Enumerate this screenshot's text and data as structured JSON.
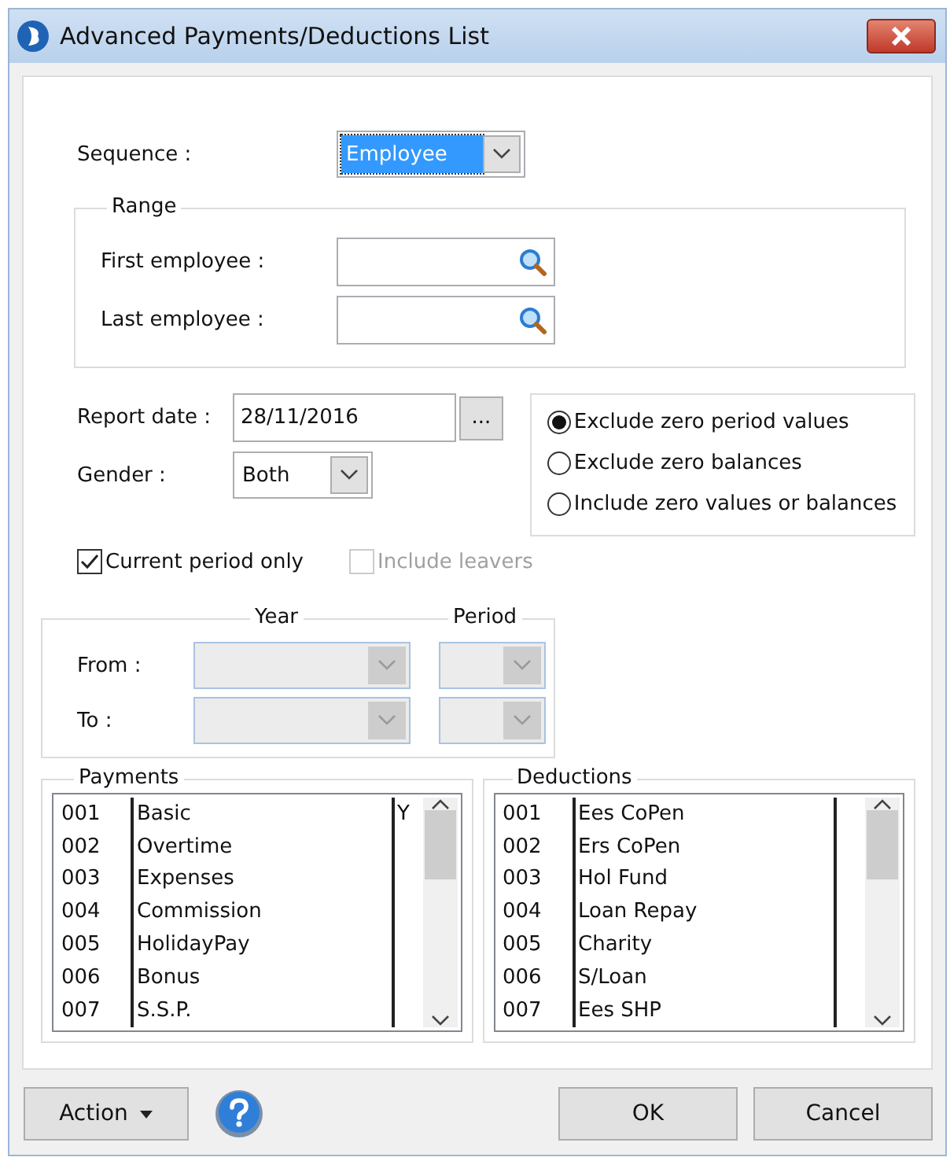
{
  "window": {
    "title": "Advanced Payments/Deductions List"
  },
  "sequence": {
    "label": "Sequence :",
    "value": "Employee",
    "focused": true
  },
  "range": {
    "title": "Range",
    "fields": [
      {
        "label": "First employee :"
      },
      {
        "label": "Last employee :"
      }
    ]
  },
  "report_date": {
    "label": "Report date :",
    "value": "28/11/2016",
    "button": "..."
  },
  "gender": {
    "label": "Gender :",
    "value": "Both"
  },
  "zero_options": [
    {
      "label": "Exclude zero period values",
      "selected": true
    },
    {
      "label": "Exclude zero balances",
      "selected": false
    },
    {
      "label": "Include zero values or balances",
      "selected": false
    }
  ],
  "checkboxes": [
    {
      "label": "Current period only",
      "checked": true,
      "disabled": false
    },
    {
      "label": "Include leavers",
      "checked": false,
      "disabled": true
    }
  ],
  "period_range": {
    "columns": [
      "Year",
      "Period"
    ],
    "rows": [
      {
        "label": "From :",
        "disabled": true
      },
      {
        "label": "To :",
        "disabled": true
      }
    ]
  },
  "lists": [
    {
      "title": "Payments",
      "rows": [
        {
          "code": "001",
          "name": "Basic",
          "flag": "Y"
        },
        {
          "code": "002",
          "name": "Overtime"
        },
        {
          "code": "003",
          "name": "Expenses"
        },
        {
          "code": "004",
          "name": "Commission"
        },
        {
          "code": "005",
          "name": "HolidayPay"
        },
        {
          "code": "006",
          "name": "Bonus"
        },
        {
          "code": "007",
          "name": "S.S.P."
        }
      ]
    },
    {
      "title": "Deductions",
      "rows": [
        {
          "code": "001",
          "name": "Ees CoPen"
        },
        {
          "code": "002",
          "name": "Ers CoPen"
        },
        {
          "code": "003",
          "name": "Hol Fund"
        },
        {
          "code": "004",
          "name": "Loan Repay"
        },
        {
          "code": "005",
          "name": "Charity"
        },
        {
          "code": "006",
          "name": "S/Loan"
        },
        {
          "code": "007",
          "name": "Ees SHP"
        }
      ]
    }
  ],
  "buttons": {
    "action": "Action",
    "ok": "OK",
    "cancel": "Cancel"
  }
}
